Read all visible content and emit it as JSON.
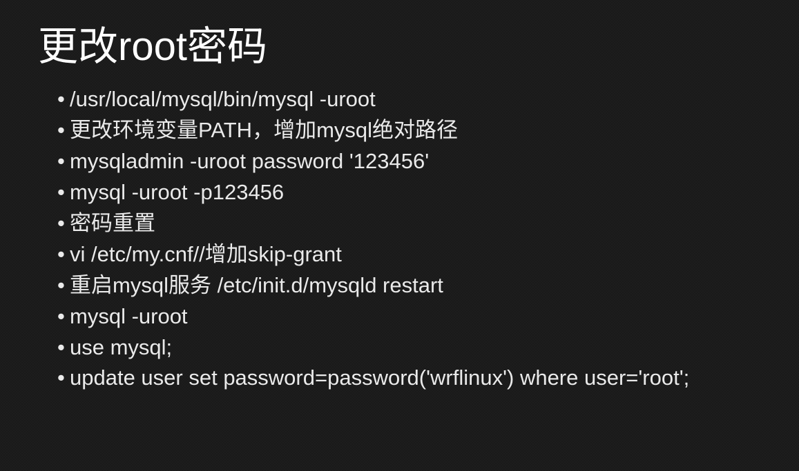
{
  "slide": {
    "title": "更改root密码",
    "bullets": [
      "/usr/local/mysql/bin/mysql -uroot",
      "更改环境变量PATH，增加mysql绝对路径",
      "mysqladmin -uroot password '123456'",
      "mysql -uroot -p123456",
      "密码重置",
      "vi /etc/my.cnf//增加skip-grant",
      "重启mysql服务 /etc/init.d/mysqld restart",
      "mysql -uroot",
      "use mysql;",
      "update user set password=password('wrflinux') where user='root';"
    ]
  }
}
